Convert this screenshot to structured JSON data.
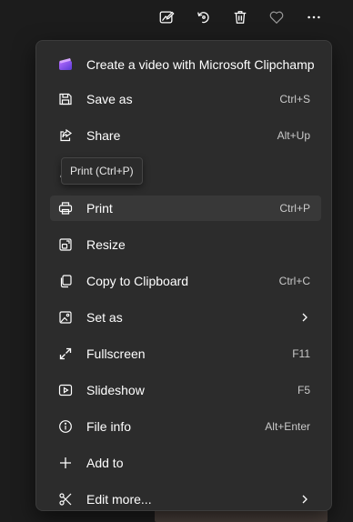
{
  "toolbar": {
    "icons": [
      "edit-image-icon",
      "rotate-icon",
      "delete-icon",
      "favorite-icon",
      "more-icon"
    ]
  },
  "menu": {
    "items": [
      {
        "label": "Create a video with Microsoft Clipchamp",
        "shortcut": "",
        "icon": "clipchamp-icon"
      },
      {
        "label": "Save as",
        "shortcut": "Ctrl+S",
        "icon": "save-icon"
      },
      {
        "label": "Share",
        "shortcut": "Alt+Up",
        "icon": "share-icon"
      },
      {
        "label": "",
        "shortcut": "",
        "icon": "edit-icon"
      },
      {
        "label": "Print",
        "shortcut": "Ctrl+P",
        "icon": "print-icon"
      },
      {
        "label": "Resize",
        "shortcut": "",
        "icon": "resize-icon"
      },
      {
        "label": "Copy to Clipboard",
        "shortcut": "Ctrl+C",
        "icon": "copy-icon"
      },
      {
        "label": "Set as",
        "shortcut": "",
        "icon": "set-as-icon"
      },
      {
        "label": "Fullscreen",
        "shortcut": "F11",
        "icon": "fullscreen-icon"
      },
      {
        "label": "Slideshow",
        "shortcut": "F5",
        "icon": "slideshow-icon"
      },
      {
        "label": "File info",
        "shortcut": "Alt+Enter",
        "icon": "info-icon"
      },
      {
        "label": "Add to",
        "shortcut": "",
        "icon": "add-icon"
      },
      {
        "label": "Edit more...",
        "shortcut": "",
        "icon": "edit-more-icon"
      }
    ],
    "highlighted": "Print"
  },
  "tooltip": {
    "text": "Print (Ctrl+P)"
  },
  "colors": {
    "menu_bg": "#2c2c2c",
    "hover_bg": "#383838",
    "page_bg": "#1c1c1c",
    "clipchamp_accent": "#7b61ff"
  }
}
